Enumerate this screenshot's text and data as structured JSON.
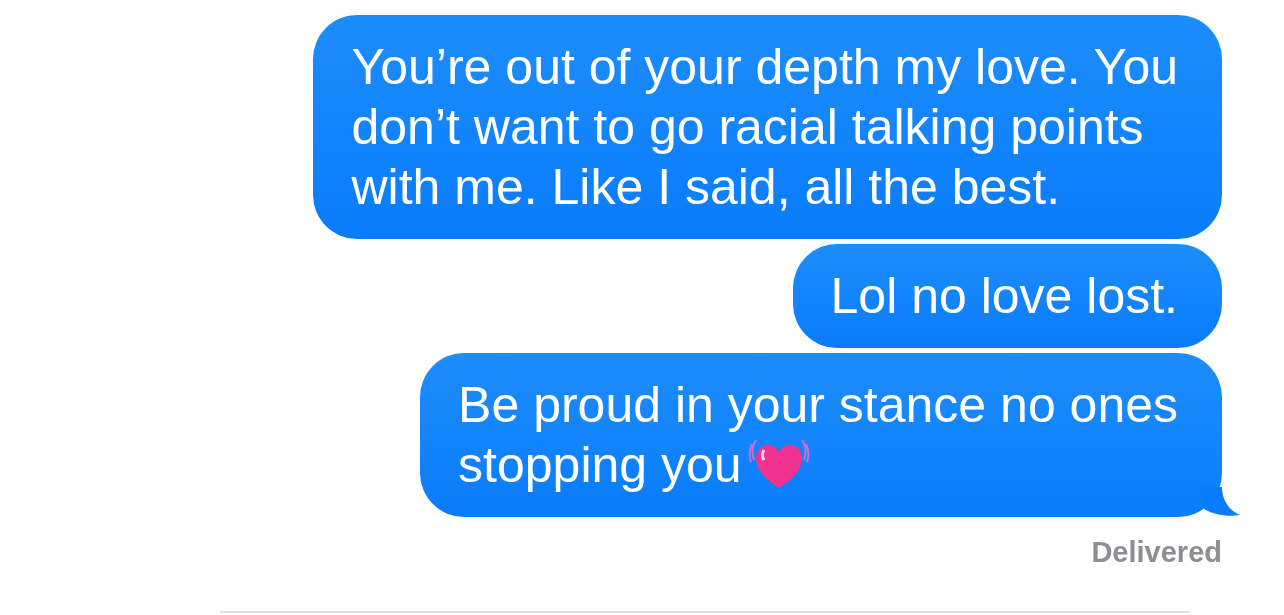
{
  "messages": [
    {
      "lines": [
        "You’re out of your depth my love. You",
        "don’t want to go racial talking points",
        "with me. Like I said, all the best."
      ],
      "tail": false
    },
    {
      "lines": [
        "Lol no love lost."
      ],
      "tail": false
    },
    {
      "lines": [
        "Be proud in your stance no ones",
        "stopping you"
      ],
      "heart_emoji": true,
      "tail": true
    }
  ],
  "status": "Delivered"
}
